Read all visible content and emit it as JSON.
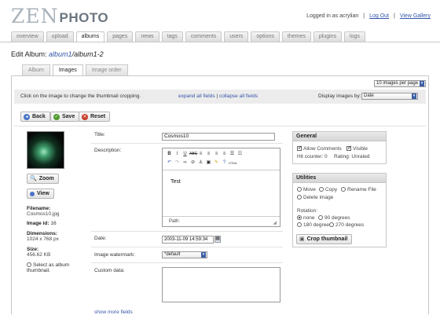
{
  "header": {
    "logo_zen": "ZEN",
    "logo_photo": "PHOTO",
    "logged_in": "Logged in as acrylian",
    "sep1": "|",
    "logout": "Log Out",
    "sep2": "|",
    "view_gallery": "View Gallery"
  },
  "main_tabs": [
    {
      "label": "overview",
      "active": false
    },
    {
      "label": "upload",
      "active": false
    },
    {
      "label": "albums",
      "active": true
    },
    {
      "label": "pages",
      "active": false
    },
    {
      "label": "news",
      "active": false
    },
    {
      "label": "tags",
      "active": false
    },
    {
      "label": "comments",
      "active": false
    },
    {
      "label": "users",
      "active": false
    },
    {
      "label": "options",
      "active": false
    },
    {
      "label": "themes",
      "active": false
    },
    {
      "label": "plugins",
      "active": false
    },
    {
      "label": "logs",
      "active": false
    }
  ],
  "edit_title": {
    "prefix": "Edit Album: ",
    "parent": "album1",
    "current": "/album1-2"
  },
  "sub_tabs": [
    {
      "label": "Album",
      "active": false
    },
    {
      "label": "Images",
      "active": true
    },
    {
      "label": "Image order",
      "active": false
    }
  ],
  "per_page": {
    "value": "10 images per page"
  },
  "toolbar": {
    "hint": "Click on the image to change the thumbnail cropping.",
    "expand": "expand all fields",
    "sep": "|",
    "collapse": "collapse all fields",
    "display_label": "Display images by:",
    "display_value": "Date"
  },
  "actions": {
    "back": "Back",
    "save": "Save",
    "reset": "Reset"
  },
  "image": {
    "zoom": "Zoom",
    "view": "View",
    "filename_label": "Filename:",
    "filename": "Cosmos10.jpg",
    "id_label": "Image id:",
    "id": "16",
    "dimensions_label": "Dimensions:",
    "dimensions": "1024 x 768 px",
    "size_label": "Size:",
    "size": "456.62 KB",
    "select_album_thumb": "Select as album thumbnail."
  },
  "fields": {
    "title_label": "Title:",
    "title_value": "Cosmos10",
    "desc_label": "Description:",
    "desc_text": "Test",
    "editor_path": "Path:",
    "date_label": "Date:",
    "date_value": "2003-11-09 14:59:34",
    "watermark_label": "Image watermark:",
    "watermark_value": "*default",
    "custom_label": "Custom data:",
    "show_more": "show more fields"
  },
  "general": {
    "title": "General",
    "allow_comments": "Allow Comments",
    "visible": "Visible",
    "hit_counter": "Hit counter: 0",
    "rating": "Rating: Unrated"
  },
  "utilities": {
    "title": "Utilities",
    "move": "Move",
    "copy": "Copy",
    "rename": "Rename File",
    "delete": "Delete image",
    "rotation_label": "Rotation:",
    "rot_none": "none",
    "rot_90": "90 degrees",
    "rot_180": "180 degrees",
    "rot_270": "270 degrees",
    "crop": "Crop thumbnail"
  },
  "colors": {
    "link": "#3355aa",
    "select_arrow": "#3b5fa8",
    "toolbar_bg": "#ececec"
  }
}
